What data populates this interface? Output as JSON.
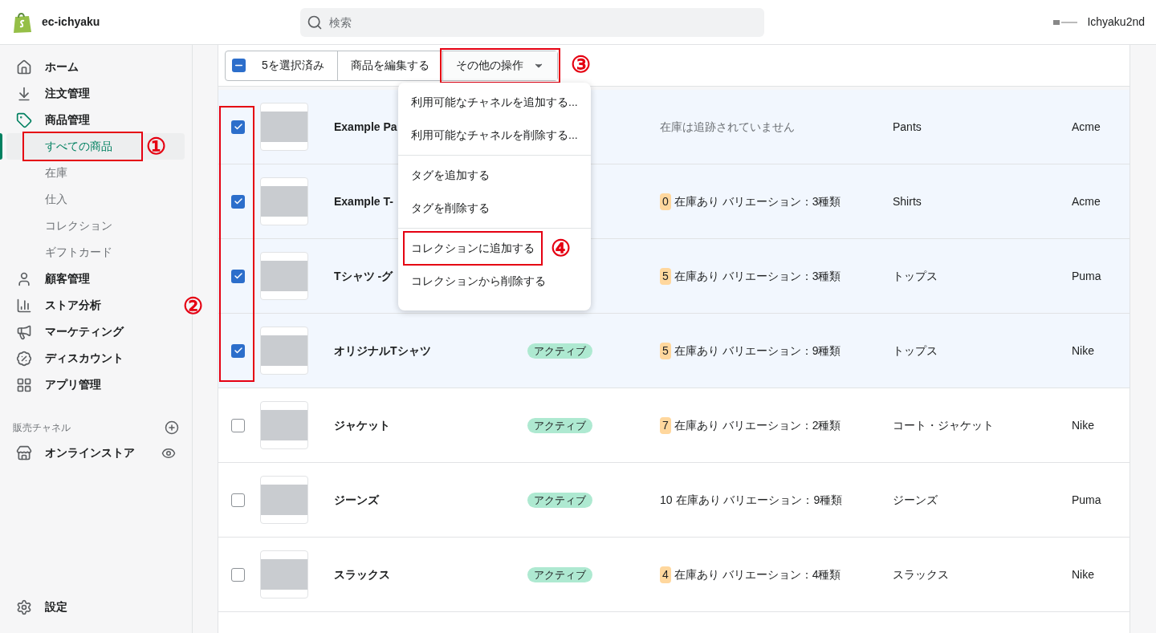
{
  "topbar": {
    "store_name": "ec-ichyaku",
    "search": {
      "placeholder": "検索"
    },
    "account": {
      "name": "Ichyaku2nd"
    }
  },
  "sidebar": {
    "items": [
      {
        "label": "ホーム",
        "selected": false
      },
      {
        "label": "注文管理",
        "selected": false
      },
      {
        "label": "商品管理",
        "selected": false,
        "children": [
          {
            "label": "すべての商品",
            "selected": true,
            "annotation": "①"
          },
          {
            "label": "在庫",
            "selected": false
          },
          {
            "label": "仕入",
            "selected": false
          },
          {
            "label": "コレクション",
            "selected": false
          },
          {
            "label": "ギフトカード",
            "selected": false
          }
        ]
      },
      {
        "label": "顧客管理",
        "selected": false
      },
      {
        "label": "ストア分析",
        "selected": false
      },
      {
        "label": "マーケティング",
        "selected": false
      },
      {
        "label": "ディスカウント",
        "selected": false
      },
      {
        "label": "アプリ管理",
        "selected": false
      }
    ],
    "sales_channels": {
      "heading": "販売チャネル",
      "items": [
        {
          "label": "オンラインストア"
        }
      ]
    },
    "settings": {
      "label": "設定"
    }
  },
  "bulk_actions": {
    "select_all": {
      "indeterminate": true,
      "label": "5を選択済み"
    },
    "buttons": [
      {
        "label": "商品を編集する",
        "kind": "plain"
      },
      {
        "label": "その他の操作",
        "kind": "dropdown",
        "expanded": true,
        "annotation": "③"
      }
    ],
    "menu": {
      "sections": [
        {
          "items": [
            {
              "label": "利用可能なチャネルを追加する..."
            },
            {
              "label": "利用可能なチャネルを削除する..."
            }
          ]
        },
        {
          "items": [
            {
              "label": "タグを追加する"
            },
            {
              "label": "タグを削除する"
            }
          ]
        },
        {
          "items": [
            {
              "label": "コレクションに追加する",
              "annotation": "④"
            },
            {
              "label": "コレクションから削除する"
            }
          ]
        }
      ]
    }
  },
  "table": {
    "checkbox_annotation": "②",
    "rows": [
      {
        "checked": true,
        "name": "Example Pa",
        "inventory": {
          "kind": "untracked",
          "text": "在庫は追跡されていません"
        },
        "type": "Pants",
        "vendor": "Acme"
      },
      {
        "checked": true,
        "name": "Example T-",
        "inventory": {
          "kind": "tracked",
          "count": "0",
          "low": true,
          "text": "在庫あり バリエーション：3種類"
        },
        "type": "Shirts",
        "vendor": "Acme"
      },
      {
        "checked": true,
        "name": "Tシャツ -グ",
        "inventory": {
          "kind": "tracked",
          "count": "5",
          "low": true,
          "text": "在庫あり バリエーション：3種類"
        },
        "type": "トップス",
        "vendor": "Puma"
      },
      {
        "checked": true,
        "name": "オリジナルTシャツ",
        "status": "アクティブ",
        "inventory": {
          "kind": "tracked",
          "count": "5",
          "low": true,
          "text": "在庫あり バリエーション：9種類"
        },
        "type": "トップス",
        "vendor": "Nike"
      },
      {
        "checked": false,
        "name": "ジャケット",
        "status": "アクティブ",
        "inventory": {
          "kind": "tracked",
          "count": "7",
          "low": true,
          "text": "在庫あり バリエーション：2種類"
        },
        "type": "コート・ジャケット",
        "vendor": "Nike"
      },
      {
        "checked": false,
        "name": "ジーンズ",
        "status": "アクティブ",
        "inventory": {
          "kind": "tracked",
          "count": "10",
          "low": false,
          "text": "在庫あり バリエーション：9種類"
        },
        "type": "ジーンズ",
        "vendor": "Puma"
      },
      {
        "checked": false,
        "name": "スラックス",
        "status": "アクティブ",
        "inventory": {
          "kind": "tracked",
          "count": "4",
          "low": true,
          "text": "在庫あり バリエーション：4種類"
        },
        "type": "スラックス",
        "vendor": "Nike"
      }
    ]
  }
}
